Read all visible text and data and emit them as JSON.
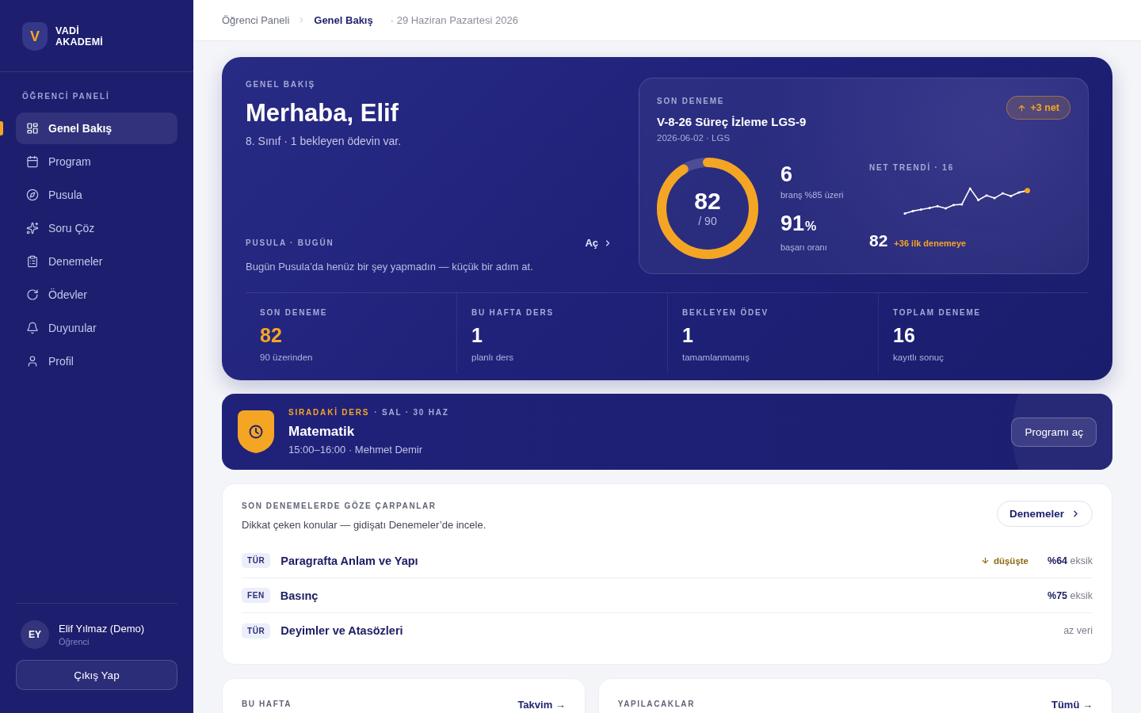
{
  "sidebar": {
    "logo": {
      "mark": "V",
      "name_lines": [
        "VADİ",
        "AKADEMİ"
      ]
    },
    "section_label": "ÖĞRENCİ PANELİ",
    "items": [
      {
        "label": "Genel Bakış",
        "selected": true
      },
      {
        "label": "Program",
        "selected": false
      },
      {
        "label": "Pusula",
        "selected": false
      },
      {
        "label": "Soru Çöz",
        "selected": false
      },
      {
        "label": "Denemeler",
        "selected": false
      },
      {
        "label": "Ödevler",
        "selected": false
      },
      {
        "label": "Duyurular",
        "selected": false
      },
      {
        "label": "Profil",
        "selected": false
      }
    ],
    "user": {
      "initials": "EY",
      "name": "Elif Yılmaz (Demo)",
      "role": "Öğrenci"
    },
    "logout_button": "Çıkış Yap"
  },
  "header": {
    "breadcrumb": [
      "Öğrenci Paneli",
      "Genel Bakış"
    ],
    "date": "· 29 Haziran Pazartesi 2026"
  },
  "overview": {
    "eyebrow": "GENEL BAKIŞ",
    "greeting": "Merhaba, Elif",
    "subtitle": "8. Sınıf · 1 bekleyen ödevin var.",
    "compass": {
      "title": "PUSULA · BUGÜN",
      "link": "Aç",
      "message": "Bugün Pusula’da henüz bir şey yapmadın — küçük bir adım at."
    },
    "last_exam": {
      "eyebrow": "SON DENEME",
      "title": "V-8-26 Süreç İzleme LGS-9",
      "meta": "2026-06-02 · LGS",
      "badge": "+3 net",
      "score": {
        "value": "82",
        "max": "/ 90",
        "level": 0.911
      },
      "highlights": [
        {
          "value": "6",
          "label": "branş %85 üzeri"
        },
        {
          "value": "91",
          "unit": "%",
          "label": "başarı oranı"
        }
      ],
      "trend": {
        "title": "NET TRENDİ · 16",
        "value": "82",
        "delta": "+36 ilk denemeye"
      }
    },
    "stats": [
      {
        "label": "SON DENEME",
        "value": "82",
        "note": "90 üzerinden",
        "highlighted": true
      },
      {
        "label": "BU HAFTA DERS",
        "value": "1",
        "note": "planlı ders",
        "highlighted": false
      },
      {
        "label": "BEKLEYEN ÖDEV",
        "value": "1",
        "note": "tamamlanmamış",
        "highlighted": false
      },
      {
        "label": "TOPLAM DENEME",
        "value": "16",
        "note": "kayıtlı sonuç",
        "highlighted": false
      }
    ]
  },
  "next_lesson": {
    "eyebrow": "SIRADAKİ DERS",
    "date": "· SAL · 30 HAZ",
    "subject": "Matematik",
    "details": "15:00–16:00 · Mehmet Demir",
    "button": "Programı aç"
  },
  "focus_topics": {
    "title": "SON DENEMELERDE GÖZE ÇARPANLAR",
    "subtitle": "Dikkat çeken konular — gidişatı Denemeler’de incele.",
    "button": "Denemeler",
    "rows": [
      {
        "tag": "TÜR",
        "topic": "Paragrafta Anlam ve Yapı",
        "trend": "düşüşte",
        "status": "**%64** eksik"
      },
      {
        "tag": "FEN",
        "topic": "Basınç",
        "status": "**%75** eksik"
      },
      {
        "tag": "TÜR",
        "topic": "Deyimler ve Atasözleri",
        "status": "az veri"
      }
    ]
  },
  "bottom_cards": [
    {
      "title": "BU HAFTA",
      "link": "Takvim →"
    },
    {
      "title": "YAPILACAKLAR",
      "link": "Tümü →"
    }
  ]
}
